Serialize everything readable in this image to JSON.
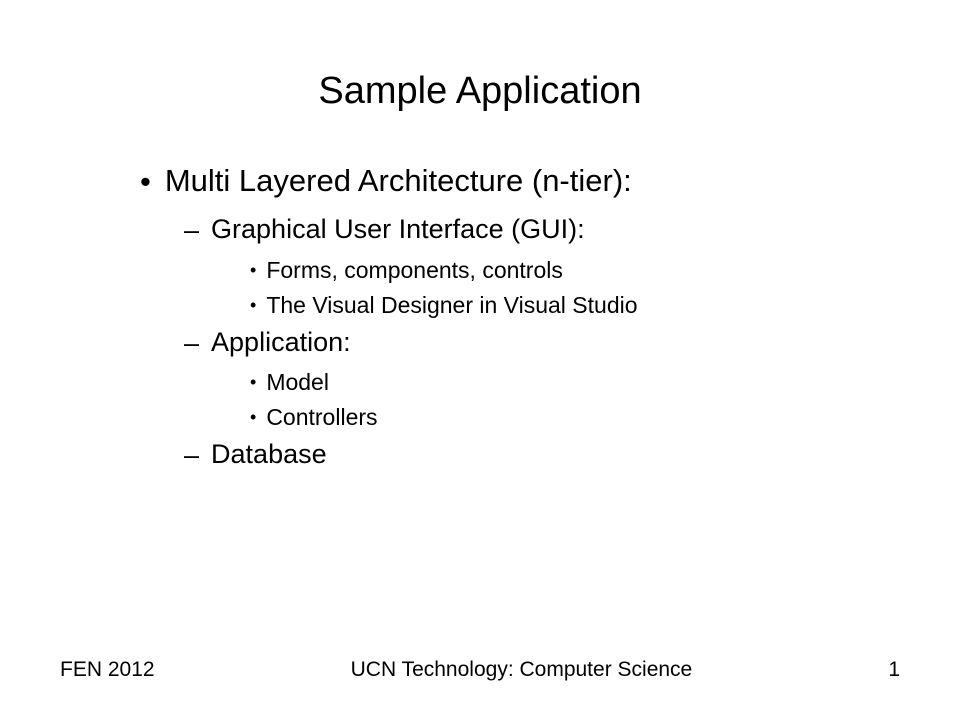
{
  "slide": {
    "title": "Sample Application",
    "bullets": {
      "main": "Multi Layered Architecture (n-tier):",
      "sub1": {
        "heading": "Graphical User Interface (GUI):",
        "items": [
          "Forms, components, controls",
          "The Visual Designer in Visual Studio"
        ]
      },
      "sub2": {
        "heading": "Application:",
        "items": [
          "Model",
          "Controllers"
        ]
      },
      "sub3": {
        "heading": "Database"
      }
    }
  },
  "footer": {
    "left": "FEN 2012",
    "center": "UCN Technology: Computer Science",
    "right": "1"
  }
}
